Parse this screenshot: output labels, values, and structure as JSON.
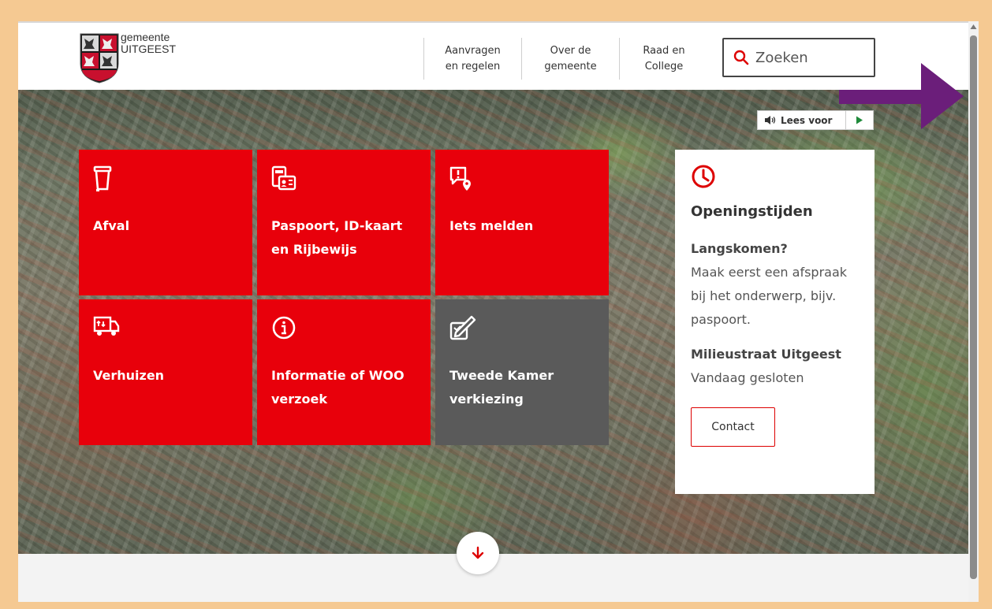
{
  "header": {
    "logo_line1": "gemeente",
    "logo_line2": "UITGEEST",
    "nav": [
      {
        "label": "Aanvragen\nen regelen"
      },
      {
        "label": "Over de\ngemeente"
      },
      {
        "label": "Raad en\nCollege"
      }
    ],
    "search_placeholder": "Zoeken"
  },
  "read_aloud": {
    "label": "Lees voor"
  },
  "tiles": [
    {
      "label": "Afval",
      "icon": "trash-bin-icon"
    },
    {
      "label": "Paspoort, ID-kaart en Rijbewijs",
      "icon": "id-card-icon"
    },
    {
      "label": "Iets melden",
      "icon": "report-location-icon"
    },
    {
      "label": "Verhuizen",
      "icon": "moving-truck-icon"
    },
    {
      "label": "Informatie of WOO verzoek",
      "icon": "info-icon"
    },
    {
      "label": "Tweede Kamer verkiezing",
      "icon": "vote-pencil-icon"
    }
  ],
  "opening_hours": {
    "title": "Openingstijden",
    "heading1": "Langskomen?",
    "text1": "Maak eerst een afspraak bij het onderwerp, bijv. paspoort.",
    "heading2": "Milieustraat Uitgeest",
    "text2": "Vandaag gesloten",
    "contact_label": "Contact"
  },
  "colors": {
    "accent_red": "#e8000b",
    "tile_gray": "#5a5a5a",
    "overlay_arrow": "#6b1e7a",
    "frame": "#f5c992"
  }
}
